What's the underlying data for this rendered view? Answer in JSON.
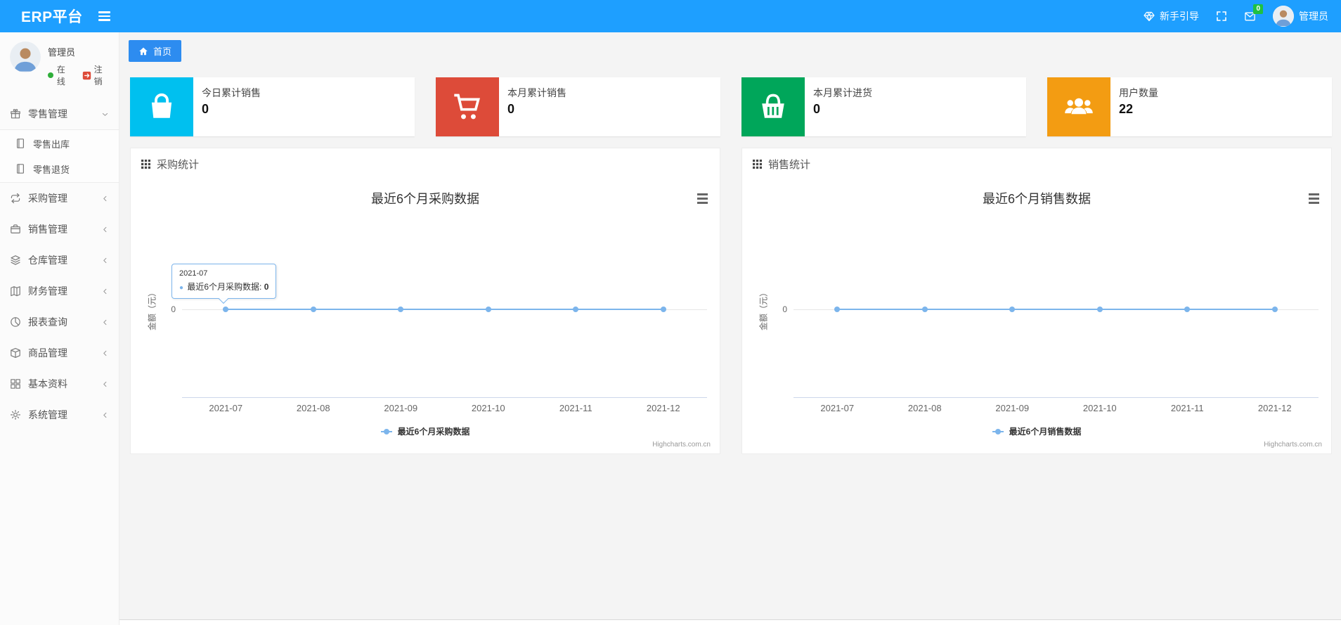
{
  "navbar": {
    "brand": "ERP平台",
    "guide_label": "新手引导",
    "badge_count": "0",
    "username": "管理员"
  },
  "sidebar": {
    "user": {
      "name": "管理员",
      "status": "在线",
      "logout": "注销"
    },
    "menu": [
      {
        "label": "零售管理",
        "icon": "gift-icon",
        "expanded": true,
        "children": [
          {
            "label": "零售出库",
            "icon": "journal-icon"
          },
          {
            "label": "零售退货",
            "icon": "journal-icon"
          }
        ]
      },
      {
        "label": "采购管理",
        "icon": "repeat-icon",
        "expanded": false
      },
      {
        "label": "销售管理",
        "icon": "briefcase-icon",
        "expanded": false
      },
      {
        "label": "仓库管理",
        "icon": "layers-icon",
        "expanded": false
      },
      {
        "label": "财务管理",
        "icon": "map-book-icon",
        "expanded": false
      },
      {
        "label": "报表查询",
        "icon": "pie-chart-icon",
        "expanded": false
      },
      {
        "label": "商品管理",
        "icon": "box-icon",
        "expanded": false
      },
      {
        "label": "基本资料",
        "icon": "grid-icon",
        "expanded": false
      },
      {
        "label": "系统管理",
        "icon": "gear-icon",
        "expanded": false
      }
    ]
  },
  "breadcrumb": {
    "home_label": "首页"
  },
  "cards": [
    {
      "title": "今日累计销售",
      "value": "0",
      "color": "#00c0ef",
      "icon": "shopping-bag-icon"
    },
    {
      "title": "本月累计销售",
      "value": "0",
      "color": "#dd4b39",
      "icon": "shopping-cart-icon"
    },
    {
      "title": "本月累计进货",
      "value": "0",
      "color": "#00a65a",
      "icon": "shopping-basket-icon"
    },
    {
      "title": "用户数量",
      "value": "22",
      "color": "#f39c12",
      "icon": "users-icon"
    }
  ],
  "panels": [
    {
      "title": "采购统计"
    },
    {
      "title": "销售统计"
    }
  ],
  "chart_data": [
    {
      "type": "line",
      "title": "最近6个月采购数据",
      "categories": [
        "2021-07",
        "2021-08",
        "2021-09",
        "2021-10",
        "2021-11",
        "2021-12"
      ],
      "series": [
        {
          "name": "最近6个月采购数据",
          "values": [
            0,
            0,
            0,
            0,
            0,
            0
          ]
        }
      ],
      "xlabel": "",
      "ylabel": "金额（元）",
      "ytick_labels": [
        "0"
      ],
      "line_color": "#7cb5ec",
      "grid": true,
      "legend_position": "bottom",
      "credit": "Highcharts.com.cn",
      "tooltip": {
        "category": "2021-07",
        "series_name": "最近6个月采购数据",
        "value": "0"
      }
    },
    {
      "type": "line",
      "title": "最近6个月销售数据",
      "categories": [
        "2021-07",
        "2021-08",
        "2021-09",
        "2021-10",
        "2021-11",
        "2021-12"
      ],
      "series": [
        {
          "name": "最近6个月销售数据",
          "values": [
            0,
            0,
            0,
            0,
            0,
            0
          ]
        }
      ],
      "xlabel": "",
      "ylabel": "金额（元）",
      "ytick_labels": [
        "0"
      ],
      "line_color": "#7cb5ec",
      "grid": true,
      "legend_position": "bottom",
      "credit": "Highcharts.com.cn"
    }
  ]
}
